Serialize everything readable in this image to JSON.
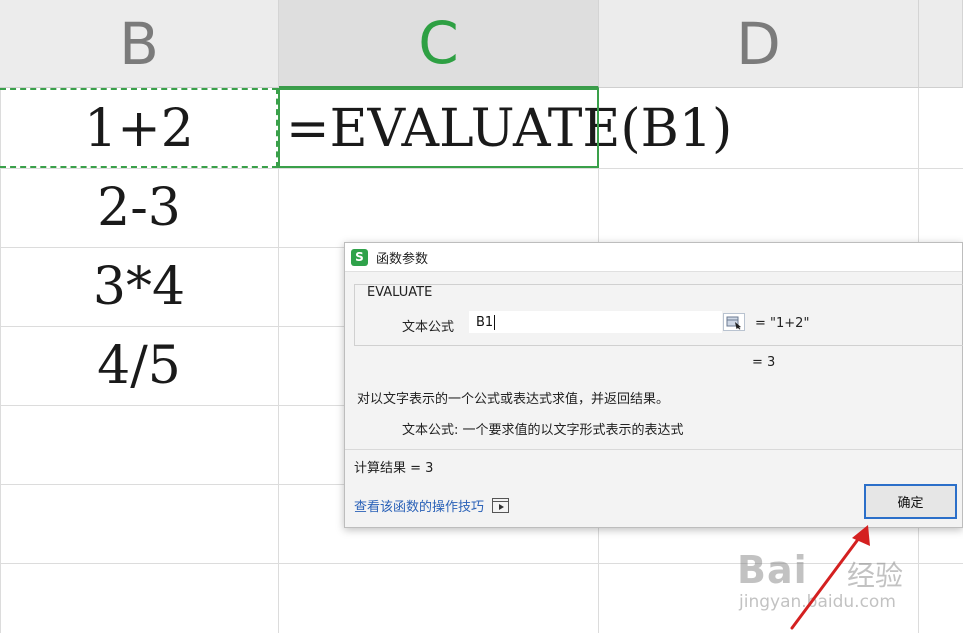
{
  "columns": [
    {
      "letter": "B",
      "active": false
    },
    {
      "letter": "C",
      "active": true
    },
    {
      "letter": "D",
      "active": false
    }
  ],
  "cells": {
    "b1": "1+2",
    "b2": "2-3",
    "b3": "3*4",
    "b4": "4/5",
    "c1": "=EVALUATE(B1)"
  },
  "dialog": {
    "app_icon": "S",
    "title": "函数参数",
    "function_name": "EVALUATE",
    "arg_label": "文本公式",
    "arg_value": "B1",
    "arg_result": "= \"1+2\"",
    "formula_result": "= 3",
    "description": "对以文字表示的一个公式或表达式求值，并返回结果。",
    "arg_description": "文本公式:  一个要求值的以文字形式表示的表达式",
    "calc_result": "计算结果 = 3",
    "help_link": "查看该函数的操作技巧",
    "ok_label": "确定"
  },
  "watermark": {
    "logo": "Bai",
    "cn": "经验",
    "url": "jingyan.baidu.com"
  },
  "colors": {
    "accent_green": "#3aa04a",
    "focus_blue": "#2b6fc9",
    "link_blue": "#2b62b8",
    "arrow_red": "#d42020"
  }
}
